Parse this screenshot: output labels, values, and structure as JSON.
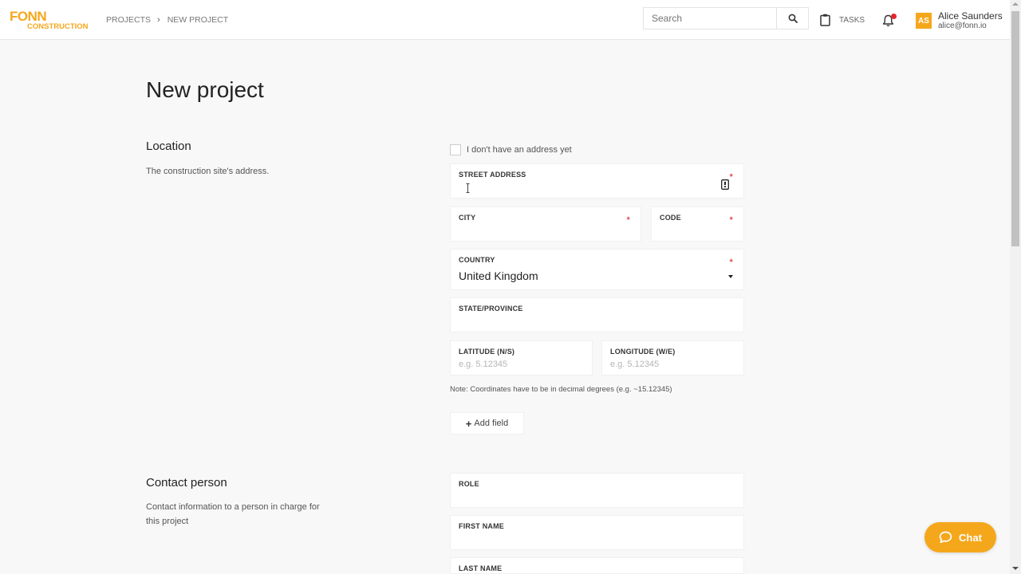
{
  "header": {
    "logo": {
      "line1": "FONN",
      "line2": "CONSTRUCTION"
    },
    "breadcrumb": {
      "items": [
        "PROJECTS",
        "NEW PROJECT"
      ],
      "separator": "›"
    },
    "search": {
      "placeholder": "Search",
      "value": ""
    },
    "tasks_label": "TASKS",
    "notifications": {
      "has_unread": true
    },
    "user": {
      "initials": "AS",
      "name": "Alice Saunders",
      "email": "alice@fonn.io"
    }
  },
  "page": {
    "title": "New project"
  },
  "location": {
    "title": "Location",
    "description": "The construction site's address.",
    "no_address_label": "I don't have an address yet",
    "no_address_checked": false,
    "street_address": {
      "label": "STREET ADDRESS",
      "required": true,
      "value": ""
    },
    "city": {
      "label": "CITY",
      "required": true,
      "value": ""
    },
    "code": {
      "label": "CODE",
      "required": true,
      "value": ""
    },
    "country": {
      "label": "COUNTRY",
      "required": true,
      "value": "United Kingdom"
    },
    "state": {
      "label": "STATE/PROVINCE",
      "required": false,
      "value": ""
    },
    "latitude": {
      "label": "LATITUDE (N/S)",
      "placeholder": "e.g. 5.12345",
      "value": ""
    },
    "longitude": {
      "label": "LONGITUDE (W/E)",
      "placeholder": "e.g. 5.12345",
      "value": ""
    },
    "note": "Note: Coordinates have to be in decimal degrees (e.g. ~15.12345)",
    "add_field_label": "Add field"
  },
  "contact": {
    "title": "Contact person",
    "description": "Contact information to a person in charge for this project",
    "role": {
      "label": "ROLE",
      "value": ""
    },
    "first_name": {
      "label": "FIRST NAME",
      "value": ""
    },
    "last_name": {
      "label": "LAST NAME",
      "value": ""
    }
  },
  "chat": {
    "label": "Chat"
  },
  "colors": {
    "accent": "#f5a71c",
    "required": "#d92020",
    "notification": "#e4262b"
  },
  "required_mark": "*"
}
